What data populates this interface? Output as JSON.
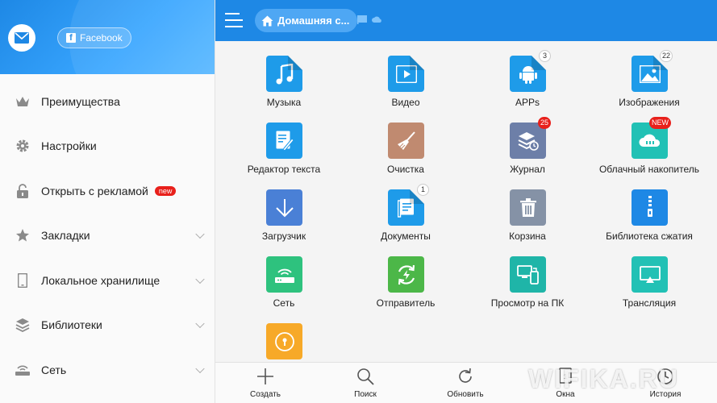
{
  "drawer": {
    "facebook_label": "Facebook",
    "items": [
      {
        "label": "Преимущества",
        "icon": "crown-icon"
      },
      {
        "label": "Настройки",
        "icon": "gear-icon"
      },
      {
        "label": "Открыть с рекламой",
        "icon": "unlock-icon",
        "badge": "new"
      },
      {
        "label": "Закладки",
        "icon": "star-icon"
      },
      {
        "label": "Локальное хранилище",
        "icon": "phone-icon"
      },
      {
        "label": "Библиотеки",
        "icon": "layers-icon"
      },
      {
        "label": "Сеть",
        "icon": "router-icon"
      }
    ]
  },
  "topbar": {
    "breadcrumb": "Домашняя с..."
  },
  "tiles": [
    {
      "label": "Музыка",
      "icon": "music-icon",
      "color": "#1e9be9"
    },
    {
      "label": "Видео",
      "icon": "video-icon",
      "color": "#1e9be9"
    },
    {
      "label": "APPs",
      "icon": "android-icon",
      "color": "#1e9be9",
      "badge": "3"
    },
    {
      "label": "Изображения",
      "icon": "image-icon",
      "color": "#1e9be9",
      "badge": "22"
    },
    {
      "label": "Редактор текста",
      "icon": "text-editor-icon",
      "color": "#1e9be9"
    },
    {
      "label": "Очистка",
      "icon": "broom-icon",
      "color": "#c08a70"
    },
    {
      "label": "Журнал",
      "icon": "journal-icon",
      "color": "#6d7fa8",
      "badge": "25",
      "badge_red": true
    },
    {
      "label": "Облачный накопитель",
      "icon": "cloud-icon",
      "color": "#22c1b5",
      "badge": "NEW",
      "badge_red": true
    },
    {
      "label": "Загрузчик",
      "icon": "download-icon",
      "color": "#4a80d6"
    },
    {
      "label": "Документы",
      "icon": "document-icon",
      "color": "#1e9be9",
      "badge": "1"
    },
    {
      "label": "Корзина",
      "icon": "trash-icon",
      "color": "#8592a6"
    },
    {
      "label": "Библиотека сжатия",
      "icon": "zip-icon",
      "color": "#1e88e5"
    },
    {
      "label": "Сеть",
      "icon": "network-icon",
      "color": "#2ec27e"
    },
    {
      "label": "Отправитель",
      "icon": "sender-icon",
      "color": "#4cb748"
    },
    {
      "label": "Просмотр на ПК",
      "icon": "pc-view-icon",
      "color": "#1fb5a8"
    },
    {
      "label": "Трансляция",
      "icon": "cast-icon",
      "color": "#22c1b5"
    },
    {
      "label": "",
      "icon": "safe-icon",
      "color": "#f7a928"
    }
  ],
  "bottombar": [
    {
      "label": "Создать",
      "icon": "plus-icon"
    },
    {
      "label": "Поиск",
      "icon": "search-icon"
    },
    {
      "label": "Обновить",
      "icon": "refresh-icon"
    },
    {
      "label": "Окна",
      "icon": "windows-icon"
    },
    {
      "label": "История",
      "icon": "history-icon"
    }
  ],
  "watermark": "WIFIKA.RU"
}
